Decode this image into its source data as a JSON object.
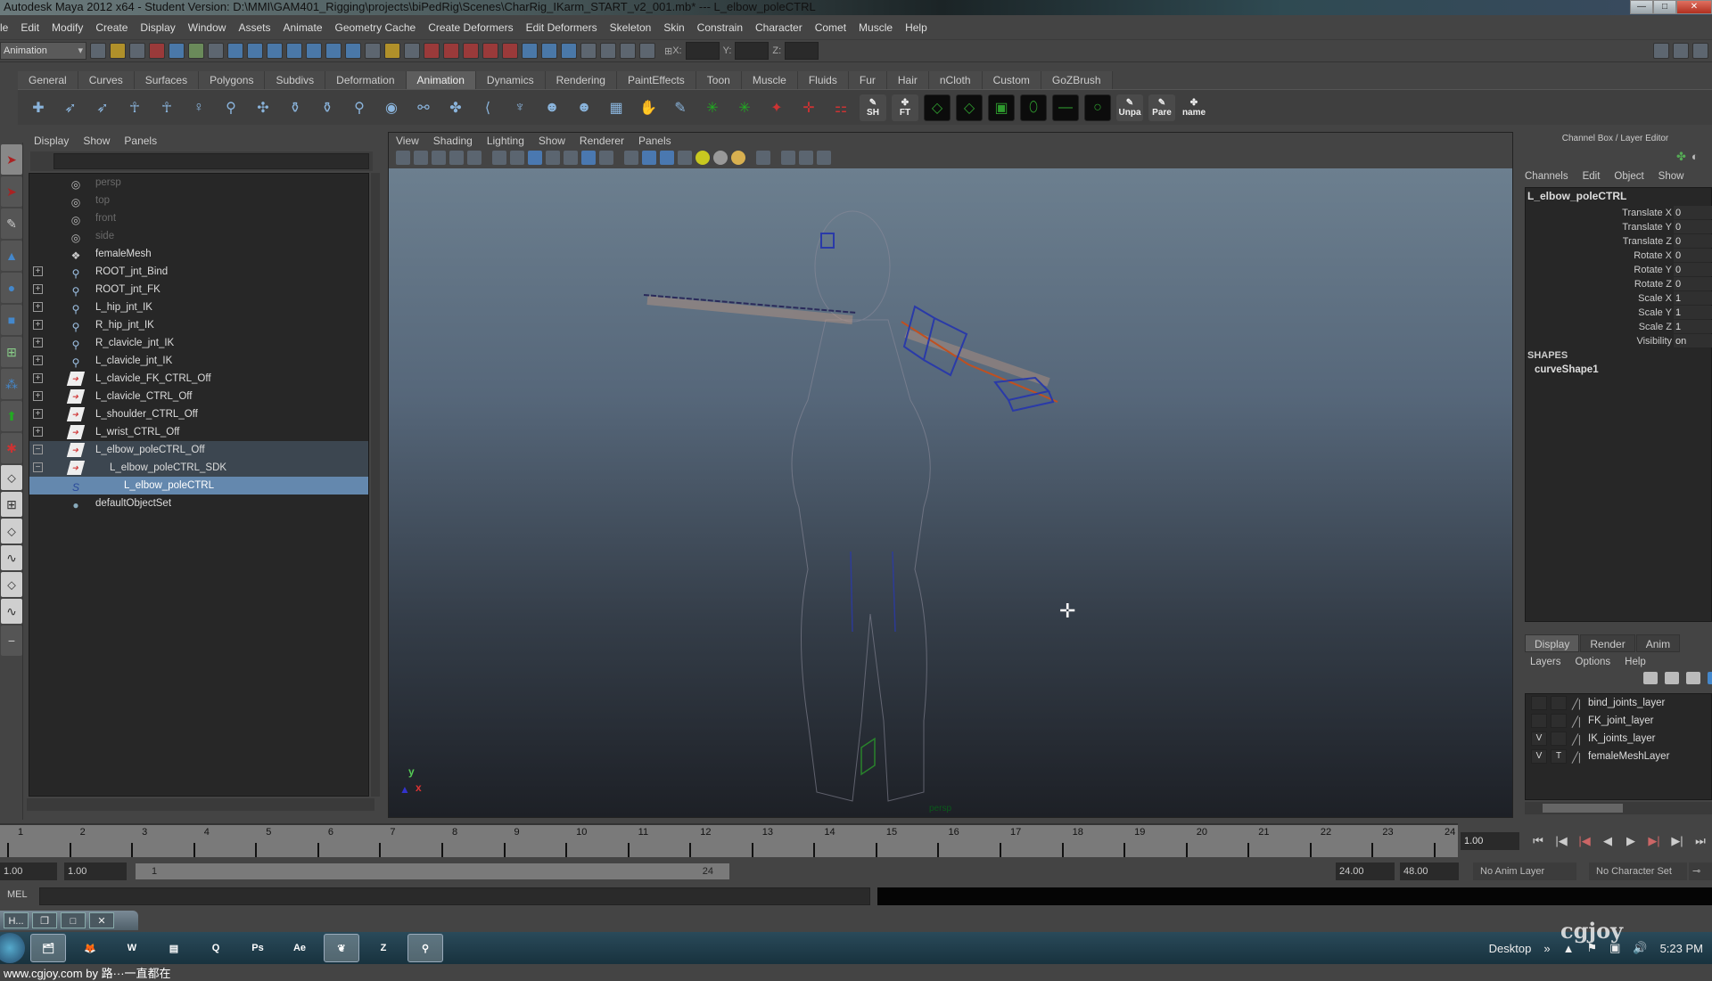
{
  "window": {
    "title": "Autodesk Maya 2012 x64 - Student Version: D:\\MMI\\GAM401_Rigging\\projects\\biPedRig\\Scenes\\CharRig_IKarm_START_v2_001.mb*   ---   L_elbow_poleCTRL",
    "controls": [
      "minimize",
      "maximize",
      "close"
    ]
  },
  "menubar": [
    "le",
    "Edit",
    "Modify",
    "Create",
    "Display",
    "Window",
    "Assets",
    "Animate",
    "Geometry Cache",
    "Create Deformers",
    "Edit Deformers",
    "Skeleton",
    "Skin",
    "Constrain",
    "Character",
    "Comet",
    "Muscle",
    "Help"
  ],
  "statusline": {
    "mode": "Animation",
    "x_label": "X:",
    "y_label": "Y:",
    "z_label": "Z:",
    "x_value": "",
    "y_value": "",
    "z_value": ""
  },
  "shelf": {
    "tabs": [
      "General",
      "Curves",
      "Surfaces",
      "Polygons",
      "Subdivs",
      "Deformation",
      "Animation",
      "Dynamics",
      "Rendering",
      "PaintEffects",
      "Toon",
      "Muscle",
      "Fluids",
      "Fur",
      "Hair",
      "nCloth",
      "Custom",
      "GoZBrush"
    ],
    "active_tab": "Animation",
    "labeled_buttons": [
      "SH",
      "FT",
      "Unpa",
      "Pare",
      "name"
    ]
  },
  "outliner": {
    "menu": [
      "Display",
      "Show",
      "Panels"
    ],
    "filter_value": "",
    "items": [
      {
        "name": "persp",
        "icon": "camera-icon",
        "expand": "",
        "state": "dim"
      },
      {
        "name": "top",
        "icon": "camera-icon",
        "expand": "",
        "state": "dim"
      },
      {
        "name": "front",
        "icon": "camera-icon",
        "expand": "",
        "state": "dim"
      },
      {
        "name": "side",
        "icon": "camera-icon",
        "expand": "",
        "state": "dim"
      },
      {
        "name": "femaleMesh",
        "icon": "mesh-icon",
        "expand": "",
        "state": ""
      },
      {
        "name": "ROOT_jnt_Bind",
        "icon": "joint-icon",
        "expand": "+",
        "state": ""
      },
      {
        "name": "ROOT_jnt_FK",
        "icon": "joint-icon",
        "expand": "+",
        "state": ""
      },
      {
        "name": "L_hip_jnt_IK",
        "icon": "joint-icon",
        "expand": "+",
        "state": ""
      },
      {
        "name": "R_hip_jnt_IK",
        "icon": "joint-icon",
        "expand": "+",
        "state": ""
      },
      {
        "name": "R_clavicle_jnt_IK",
        "icon": "joint-icon",
        "expand": "+",
        "state": ""
      },
      {
        "name": "L_clavicle_jnt_IK",
        "icon": "joint-icon",
        "expand": "+",
        "state": ""
      },
      {
        "name": "L_clavicle_FK_CTRL_Off",
        "icon": "transform-icon",
        "expand": "+",
        "state": ""
      },
      {
        "name": "L_clavicle_CTRL_Off",
        "icon": "transform-icon",
        "expand": "+",
        "state": ""
      },
      {
        "name": "L_shoulder_CTRL_Off",
        "icon": "transform-icon",
        "expand": "+",
        "state": ""
      },
      {
        "name": "L_wrist_CTRL_Off",
        "icon": "transform-icon",
        "expand": "+",
        "state": ""
      },
      {
        "name": "L_elbow_poleCTRL_Off",
        "icon": "transform-icon",
        "expand": "−",
        "state": "par",
        "indent": 0
      },
      {
        "name": "L_elbow_poleCTRL_SDK",
        "icon": "transform-icon",
        "expand": "−",
        "state": "par",
        "indent": 1
      },
      {
        "name": "L_elbow_poleCTRL",
        "icon": "curve-icon",
        "expand": "",
        "state": "sel",
        "indent": 2
      },
      {
        "name": "defaultObjectSet",
        "icon": "set-icon",
        "expand": "",
        "state": ""
      }
    ]
  },
  "viewport": {
    "menu": [
      "View",
      "Shading",
      "Lighting",
      "Show",
      "Renderer",
      "Panels"
    ],
    "axis": {
      "y": "y",
      "x": "x"
    },
    "camera_label": "persp"
  },
  "channelbox": {
    "header": "Channel Box / Layer Editor",
    "menu": [
      "Channels",
      "Edit",
      "Object",
      "Show"
    ],
    "object": "L_elbow_poleCTRL",
    "channels": [
      {
        "label": "Translate X",
        "value": "0"
      },
      {
        "label": "Translate Y",
        "value": "0"
      },
      {
        "label": "Translate Z",
        "value": "0"
      },
      {
        "label": "Rotate X",
        "value": "0"
      },
      {
        "label": "Rotate Y",
        "value": "0"
      },
      {
        "label": "Rotate Z",
        "value": "0"
      },
      {
        "label": "Scale X",
        "value": "1"
      },
      {
        "label": "Scale Y",
        "value": "1"
      },
      {
        "label": "Scale Z",
        "value": "1"
      },
      {
        "label": "Visibility",
        "value": "on"
      }
    ],
    "shapes_label": "SHAPES",
    "shape": "curveShape1"
  },
  "layers": {
    "tabs": [
      "Display",
      "Render",
      "Anim"
    ],
    "active_tab": "Display",
    "menu": [
      "Layers",
      "Options",
      "Help"
    ],
    "items": [
      {
        "v": "",
        "t": "",
        "name": "bind_joints_layer"
      },
      {
        "v": "",
        "t": "",
        "name": "FK_joint_layer"
      },
      {
        "v": "V",
        "t": "",
        "name": "IK_joints_layer"
      },
      {
        "v": "V",
        "t": "T",
        "name": "femaleMeshLayer"
      }
    ]
  },
  "timeline": {
    "frames": [
      "1",
      "2",
      "3",
      "4",
      "5",
      "6",
      "7",
      "8",
      "9",
      "10",
      "11",
      "12",
      "13",
      "14",
      "15",
      "16",
      "17",
      "18",
      "19",
      "20",
      "21",
      "22",
      "23",
      "24"
    ],
    "current_time": "1.00",
    "playback_buttons": [
      "⏮",
      "|◀",
      "◀|",
      "◀",
      "▶",
      "▶|",
      "▶|",
      "▶▶"
    ]
  },
  "range": {
    "start_time": "1.00",
    "playback_start": "1.00",
    "slider_start": "1",
    "slider_end": "24",
    "playback_end": "24.00",
    "end_time": "48.00",
    "anim_layer": "No Anim Layer",
    "character_set": "No Character Set"
  },
  "commandline": {
    "label": "MEL",
    "value": ""
  },
  "minimized_window": {
    "label": "H...",
    "buttons": [
      "restore",
      "maximize",
      "close"
    ]
  },
  "taskbar": {
    "apps": [
      "explorer",
      "firefox",
      "word",
      "notepad",
      "quicktime",
      "photoshop",
      "after-effects",
      "maya",
      "zbrush",
      "misc"
    ],
    "app_labels": [
      "🗂",
      "🦊",
      "W",
      "▤",
      "Q",
      "Ps",
      "Ae",
      "❦",
      "Z",
      "⚲"
    ],
    "desktop_label": "Desktop",
    "clock": "5:23 PM"
  },
  "watermark": "www.cgjoy.com by 路···一直都在",
  "logo": "cgjoy"
}
